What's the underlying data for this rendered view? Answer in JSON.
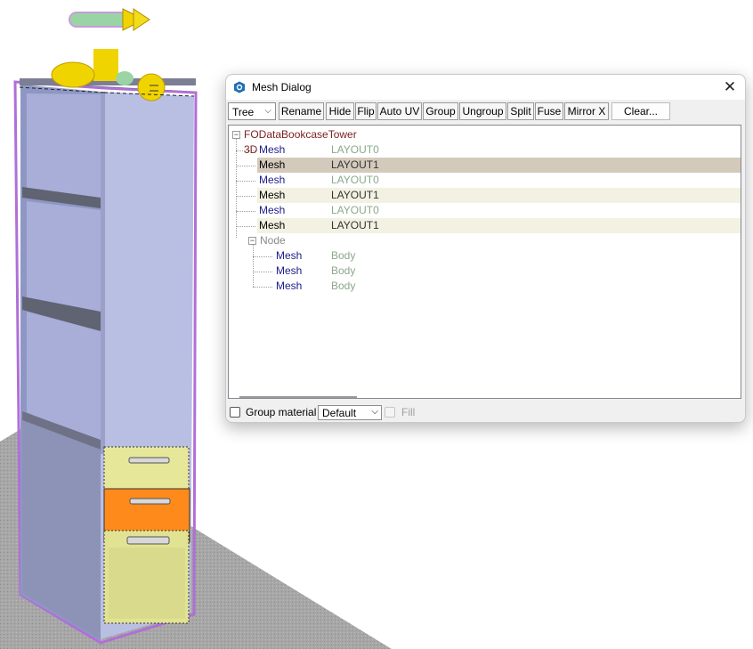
{
  "dialog": {
    "title": "Mesh Dialog",
    "app_icon": "shield-hex-icon",
    "close_glyph": "✕"
  },
  "toolbar": {
    "view_select": {
      "value": "Tree",
      "arrow": "⌵"
    },
    "buttons": [
      "Rename",
      "Hide",
      "Flip",
      "Auto UV",
      "Group",
      "Ungroup",
      "Split",
      "Fuse",
      "Mirror X",
      "Clear..."
    ]
  },
  "tree": {
    "root": {
      "label": "FODataBookcaseTower 3D",
      "expander": "⊟"
    },
    "items": [
      {
        "name": "Mesh",
        "value": "LAYOUT0",
        "selected": false,
        "dim": true
      },
      {
        "name": "Mesh",
        "value": "LAYOUT1",
        "selected": "strong",
        "dim": false
      },
      {
        "name": "Mesh",
        "value": "LAYOUT0",
        "selected": false,
        "dim": true
      },
      {
        "name": "Mesh",
        "value": "LAYOUT1",
        "selected": "light",
        "dim": false
      },
      {
        "name": "Mesh",
        "value": "LAYOUT0",
        "selected": false,
        "dim": true
      },
      {
        "name": "Mesh",
        "value": "LAYOUT1",
        "selected": "light",
        "dim": false
      }
    ],
    "node": {
      "label": "Node",
      "expander": "⊟"
    },
    "node_children": [
      {
        "name": "Mesh",
        "value": "Body"
      },
      {
        "name": "Mesh",
        "value": "Body"
      },
      {
        "name": "Mesh",
        "value": "Body"
      }
    ]
  },
  "bottom": {
    "group_material_label": "Group material",
    "material_select": {
      "value": "Default",
      "arrow": "⌵"
    },
    "fill_label": "Fill"
  },
  "colors": {
    "mesh_name": "#1c1c8c",
    "mesh_name_selected": "#000000",
    "dim_value": "#8aa88a",
    "body_value": "#8aa88a",
    "root_label": "#7a1f1f",
    "selected_strong": "#d4cabb",
    "selected_light": "#f3f1e2",
    "drawer_orange": "#ff8a1c",
    "drawer_yellow": "#e7e79a",
    "cabinet": "#b9bfe3",
    "highlight_outline": "#b06fd8",
    "gizmo_green": "#9bd4a4",
    "gizmo_yellow": "#f0d400"
  }
}
